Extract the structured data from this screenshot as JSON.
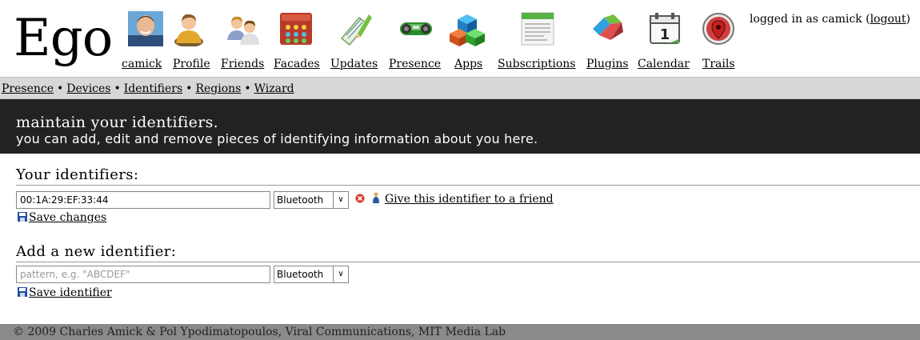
{
  "app": {
    "logo": "Ego"
  },
  "nav": {
    "items": [
      {
        "label": "camick",
        "icon": "user-avatar-icon"
      },
      {
        "label": "Profile",
        "icon": "profile-person-icon"
      },
      {
        "label": "Friends",
        "icon": "friends-people-icon"
      },
      {
        "label": "Facades",
        "icon": "facades-grid-icon"
      },
      {
        "label": "Updates",
        "icon": "updates-pencil-icon"
      },
      {
        "label": "Presence",
        "icon": "presence-device-icon"
      },
      {
        "label": "Apps",
        "icon": "apps-cubes-icon"
      },
      {
        "label": "Subscriptions",
        "icon": "subscriptions-feed-icon"
      },
      {
        "label": "Plugins",
        "icon": "plugins-puzzle-icon"
      },
      {
        "label": "Calendar",
        "icon": "calendar-icon"
      },
      {
        "label": "Trails",
        "icon": "trails-map-pin-icon"
      }
    ],
    "calendar_day": "1"
  },
  "login": {
    "prefix": "logged in as camick (",
    "logout": "logout",
    "suffix": ")"
  },
  "subnav": {
    "items": [
      "Presence",
      "Devices",
      "Identifiers",
      "Regions",
      "Wizard"
    ],
    "separator": "•"
  },
  "banner": {
    "title": "maintain your identifiers.",
    "subtitle": "you can add, edit and remove pieces of identifying information about you here."
  },
  "identifiers": {
    "title": "Your identifiers:",
    "rows": [
      {
        "value": "00:1A:29:EF:33:44",
        "type": "Bluetooth",
        "give_label": "Give this identifier to a friend"
      }
    ],
    "save_label": "Save changes"
  },
  "add_identifier": {
    "title": "Add a new identifier:",
    "placeholder": "pattern, e.g. \"ABCDEF\"",
    "type": "Bluetooth",
    "save_label": "Save identifier"
  },
  "footer": {
    "text": "© 2009 Charles Amick & Pol Ypodimatopoulos, Viral Communications, MIT Media Lab"
  },
  "colors": {
    "banner_bg": "#222222",
    "subnav_bg": "#d7d7d7",
    "footer_bg": "#8a8a8a",
    "delete_red": "#d9342b",
    "save_blue": "#1f4fa0"
  }
}
